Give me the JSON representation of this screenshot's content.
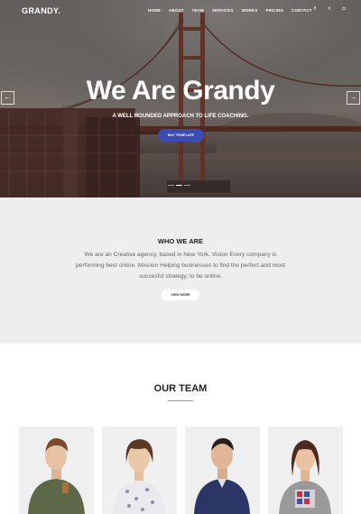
{
  "header": {
    "logo": "GRANDY.",
    "nav": [
      "HOME",
      "ABOUT",
      "TEAM",
      "SERVICES",
      "WORKS",
      "PRICING",
      "CONTACT"
    ],
    "social": [
      {
        "icon": "facebook-icon",
        "glyph": "f"
      },
      {
        "icon": "twitter-icon",
        "glyph": "t"
      },
      {
        "icon": "instagram-icon",
        "glyph": "◘"
      }
    ]
  },
  "hero": {
    "title": "We Are Grandy",
    "subtitle": "A WELL ROUNDED APPROACH TO LIFE COACHING.",
    "button": "BUY TEMPLATE",
    "prev_icon": "arrow-left-icon",
    "next_icon": "arrow-right-icon",
    "slides": 3,
    "active_slide": 1
  },
  "about": {
    "title": "WHO WE ARE",
    "text": "We are an Creative agency, based in New York. Vision Every company is performing best online. Mission Helping businesses to find the perfect and most succesful strategy, to be online.",
    "button": "VIEW MORE"
  },
  "team": {
    "title": "OUR TEAM",
    "members": 4
  },
  "colors": {
    "accent": "#3a4bb4",
    "about_bg": "#eeeeee"
  }
}
